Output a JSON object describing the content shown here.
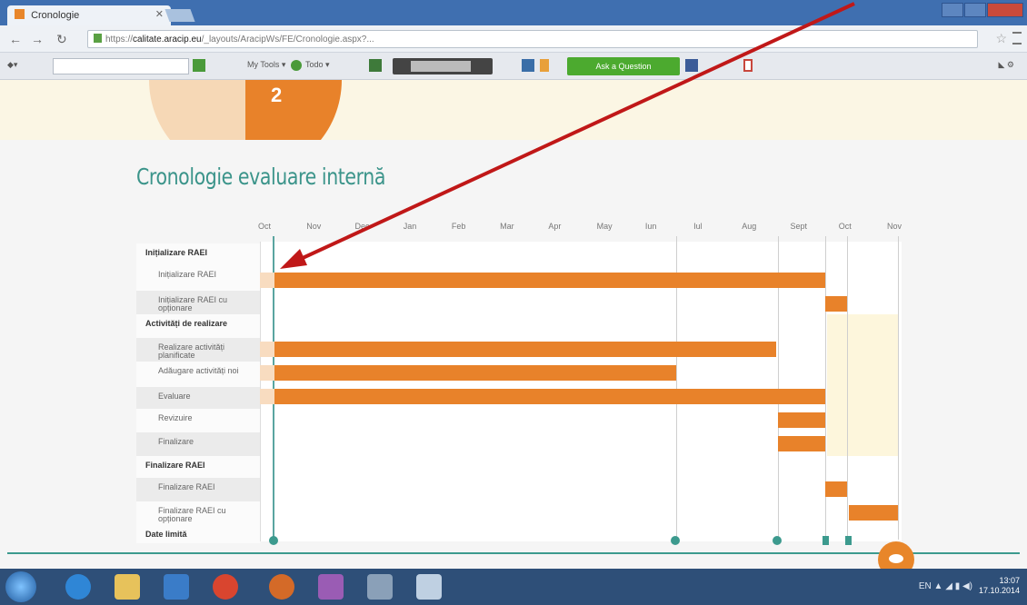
{
  "browser": {
    "tab_title": "Cronologie",
    "url_prefix": "https://",
    "url_host": "calitate.aracip.eu",
    "url_path": "/_layouts/AracipWs/FE/Cronologie.aspx?..."
  },
  "toolbar": {
    "item1": "My Tools ▾",
    "item2": "Todo ▾",
    "ask_button": "Ask a Question"
  },
  "page": {
    "pie_number": "2",
    "title": "Cronologie evaluare internă"
  },
  "gantt": {
    "months": [
      "Oct",
      "Nov",
      "Dec",
      "Jan",
      "Feb",
      "Mar",
      "Apr",
      "May",
      "Iun",
      "Iul",
      "Aug",
      "Sept",
      "Oct",
      "Nov"
    ],
    "rows": [
      {
        "label": "Inițializare RAEI",
        "type": "grp"
      },
      {
        "label": "Inițializare RAEI",
        "type": "sub"
      },
      {
        "label": "Inițializare RAEI cu opționare",
        "type": "sub"
      },
      {
        "label": "Activități de realizare",
        "type": "grp"
      },
      {
        "label": "Realizare activități planificate",
        "type": "sub"
      },
      {
        "label": "Adăugare activități noi",
        "type": "sub"
      },
      {
        "label": "Evaluare",
        "type": "sub"
      },
      {
        "label": "Revizuire",
        "type": "sub"
      },
      {
        "label": "Finalizare",
        "type": "sub"
      },
      {
        "label": "Finalizare RAEI",
        "type": "grp"
      },
      {
        "label": "Finalizare RAEI",
        "type": "sub"
      },
      {
        "label": "Finalizare RAEI cu opționare",
        "type": "sub"
      },
      {
        "label": "Date limită",
        "type": "grp"
      }
    ]
  },
  "colors": {
    "accent_orange": "#e8822a",
    "teal": "#3c9a8e"
  },
  "taskbar": {
    "clock_time": "13:07",
    "clock_date": "17.10.2014"
  }
}
